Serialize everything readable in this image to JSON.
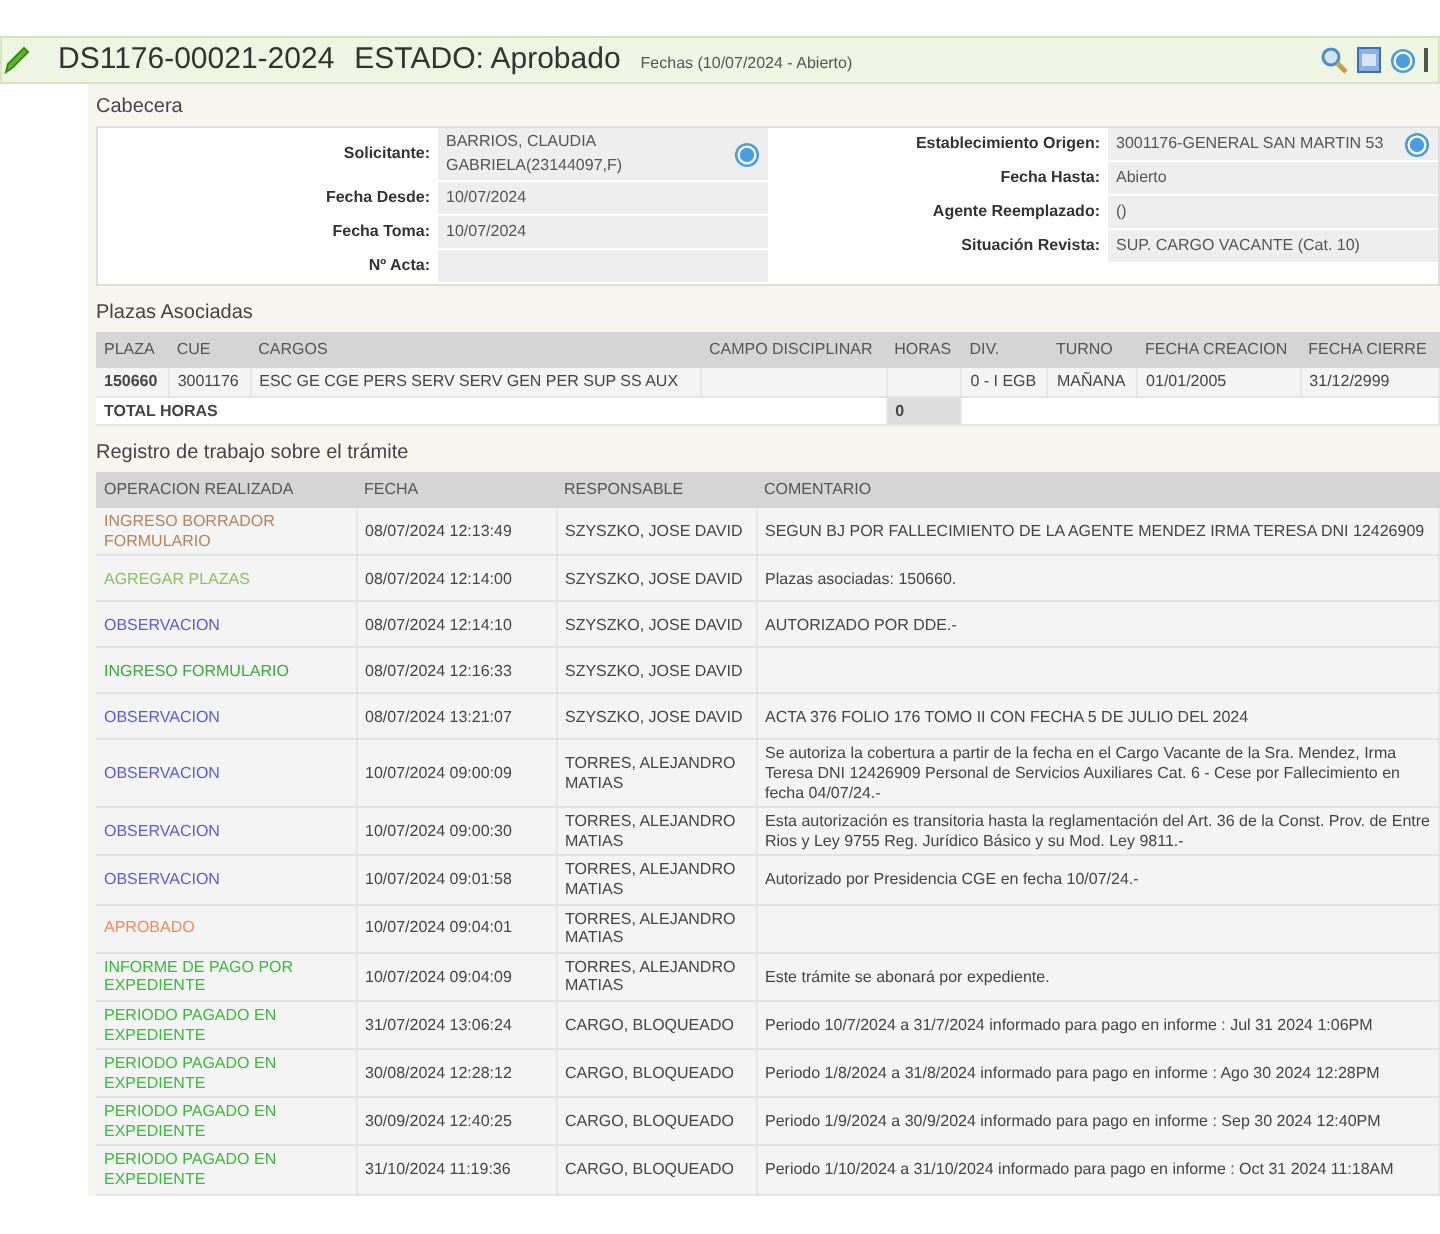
{
  "header": {
    "code": "DS1176-00021-2024",
    "estado": "ESTADO: Aprobado",
    "fechas": "Fechas (10/07/2024 - Abierto)"
  },
  "cabecera": {
    "title": "Cabecera",
    "left": [
      {
        "label": "Solicitante:",
        "value": "BARRIOS, CLAUDIA GABRIELA(23144097,F)",
        "info": true
      },
      {
        "label": "Fecha Desde:",
        "value": "10/07/2024",
        "info": false
      },
      {
        "label": "Fecha Toma:",
        "value": "10/07/2024",
        "info": false
      },
      {
        "label": "Nº Acta:",
        "info": false
      }
    ],
    "right": [
      {
        "label": "Establecimiento Origen:",
        "value": "3001176-GENERAL SAN MARTIN 53",
        "info": true
      },
      {
        "label": "Fecha Hasta:",
        "value": "Abierto",
        "info": false
      },
      {
        "label": "Agente Reemplazado:",
        "value": "()",
        "info": false
      },
      {
        "label": "Situación Revista:",
        "value": "SUP. CARGO VACANTE (Cat. 10)",
        "info": false
      }
    ]
  },
  "plazas": {
    "title": "Plazas Asociadas",
    "columns": [
      "PLAZA",
      "CUE",
      "CARGOS",
      "CAMPO DISCIPLINAR",
      "HORAS",
      "DIV.",
      "TURNO",
      "FECHA CREACION",
      "FECHA CIERRE"
    ],
    "rows": [
      [
        "150660",
        "3001176",
        "ESC GE CGE PERS SERV SERV GEN PER SUP SS AUX",
        "",
        "",
        "0 - I EGB",
        "MAÑANA",
        "01/01/2005",
        "31/12/2999"
      ]
    ],
    "total": {
      "label": "TOTAL HORAS",
      "value": "0"
    }
  },
  "registro": {
    "title": "Registro de trabajo sobre el trámite",
    "columns": [
      "OPERACION REALIZADA",
      "FECHA",
      "RESPONSABLE",
      "COMENTARIO"
    ],
    "rows": [
      {
        "operacion": "INGRESO BORRADOR FORMULARIO",
        "color": "#b5835a",
        "fecha": "08/07/2024 12:13:49",
        "responsable": "SZYSZKO, JOSE DAVID",
        "comentario": "SEGUN BJ POR FALLECIMIENTO DE LA AGENTE MENDEZ IRMA TERESA DNI 12426909"
      },
      {
        "operacion": "AGREGAR PLAZAS",
        "color": "#8cc063",
        "fecha": "08/07/2024 12:14:00",
        "responsable": "SZYSZKO, JOSE DAVID",
        "comentario": "Plazas asociadas: 150660."
      },
      {
        "operacion": "OBSERVACION",
        "color": "#5a5ae0",
        "fecha": "08/07/2024 12:14:10",
        "responsable": "SZYSZKO, JOSE DAVID",
        "comentario": "AUTORIZADO POR DDE.-"
      },
      {
        "operacion": "INGRESO FORMULARIO",
        "color": "#3aa83a",
        "fecha": "08/07/2024 12:16:33",
        "responsable": "SZYSZKO, JOSE DAVID",
        "comentario": ""
      },
      {
        "operacion": "OBSERVACION",
        "color": "#5a5ae0",
        "fecha": "08/07/2024 13:21:07",
        "responsable": "SZYSZKO, JOSE DAVID",
        "comentario": "ACTA 376 FOLIO 176 TOMO II CON FECHA 5 DE JULIO DEL 2024"
      },
      {
        "operacion": "OBSERVACION",
        "color": "#5a5ae0",
        "fecha": "10/07/2024 09:00:09",
        "responsable": "TORRES, ALEJANDRO MATIAS",
        "comentario": "Se autoriza la cobertura a partir de la fecha en el Cargo Vacante de la Sra. Mendez, Irma Teresa DNI 12426909 Personal de Servicios Auxiliares Cat. 6 - Cese por Fallecimiento en fecha 04/07/24.-"
      },
      {
        "operacion": "OBSERVACION",
        "color": "#5a5ae0",
        "fecha": "10/07/2024 09:00:30",
        "responsable": "TORRES, ALEJANDRO MATIAS",
        "comentario": "Esta autorización es transitoria hasta la reglamentación del Art. 36 de la Const. Prov. de Entre Rios y Ley 9755 Reg. Jurídico Básico y su Mod. Ley 9811.-"
      },
      {
        "operacion": "OBSERVACION",
        "color": "#5a5ae0",
        "fecha": "10/07/2024 09:01:58",
        "responsable": "TORRES, ALEJANDRO MATIAS",
        "comentario": "Autorizado por Presidencia CGE en fecha 10/07/24.-"
      },
      {
        "operacion": "APROBADO",
        "color": "#f08a5a",
        "fecha": "10/07/2024 09:04:01",
        "responsable": "TORRES, ALEJANDRO MATIAS",
        "comentario": ""
      },
      {
        "operacion": "INFORME DE PAGO POR EXPEDIENTE",
        "color": "#3cb83c",
        "fecha": "10/07/2024 09:04:09",
        "responsable": "TORRES, ALEJANDRO MATIAS",
        "comentario": "Este trámite se abonará por expediente."
      },
      {
        "operacion": "PERIODO PAGADO EN EXPEDIENTE",
        "color": "#3cb83c",
        "fecha": "31/07/2024 13:06:24",
        "responsable": "CARGO, BLOQUEADO",
        "comentario": "Periodo 10/7/2024 a 31/7/2024 informado para pago en informe : Jul 31 2024 1:06PM"
      },
      {
        "operacion": "PERIODO PAGADO EN EXPEDIENTE",
        "color": "#3cb83c",
        "fecha": "30/08/2024 12:28:12",
        "responsable": "CARGO, BLOQUEADO",
        "comentario": "Periodo 1/8/2024 a 31/8/2024 informado para pago en informe : Ago 30 2024 12:28PM"
      },
      {
        "operacion": "PERIODO PAGADO EN EXPEDIENTE",
        "color": "#3cb83c",
        "fecha": "30/09/2024 12:40:25",
        "responsable": "CARGO, BLOQUEADO",
        "comentario": "Periodo 1/9/2024 a 30/9/2024 informado para pago en informe : Sep 30 2024 12:40PM"
      },
      {
        "operacion": "PERIODO PAGADO EN EXPEDIENTE",
        "color": "#3cb83c",
        "fecha": "31/10/2024 11:19:36",
        "responsable": "CARGO, BLOQUEADO",
        "comentario": "Periodo 1/10/2024 a 31/10/2024 informado para pago en informe : Oct 31 2024 11:18AM"
      }
    ]
  }
}
